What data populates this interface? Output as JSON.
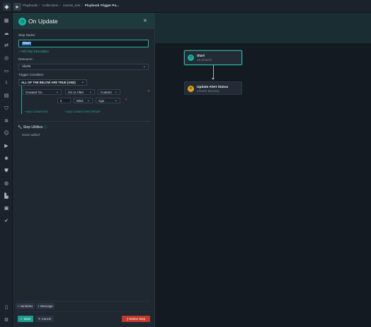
{
  "breadcrumb": {
    "items": [
      "Playbooks",
      "Collections",
      "cazzan_test"
    ],
    "current": "Playbook Trigger Po..."
  },
  "panel": {
    "title": "On Update",
    "close_glyph": "×",
    "step_name_label": "Step Name:",
    "step_name_value": "Start",
    "add_description": "+ Add Step Description",
    "resource_label": "Resource :",
    "resource_value": "Alerts",
    "trigger_label": "Trigger Condition:",
    "logic_value": "ALL OF THE BELOW ARE TRUE (AND)",
    "condition": {
      "field": "Created On",
      "operator": "On or After",
      "mode": "Custom",
      "amount": "5",
      "unit": "Mins",
      "direction": "Ago"
    },
    "remove_glyph": "×",
    "add_condition": "+ ADD CONDITION",
    "add_group": "+ ADD CONDITIONS GROUP",
    "utilities_title": "Step Utilities",
    "none_added": "None added"
  },
  "footer": {
    "variables": "+ Variables",
    "message": "+ Message",
    "save": "Save",
    "cancel": "Cancel",
    "delete": "Delete Step"
  },
  "canvas": {
    "start_title": "Start",
    "start_sub": "ON UPDATE",
    "update_title": "Update Alert Status",
    "update_sub": "UPDATE RECORD"
  },
  "colors": {
    "accent": "#27b3a3",
    "danger": "#c0392b",
    "selection": "#3a7bd5"
  },
  "icons": [
    "menu-icon",
    "play-icon",
    "chevron-down-icon",
    "close-icon",
    "wrench-icon",
    "info-icon"
  ]
}
